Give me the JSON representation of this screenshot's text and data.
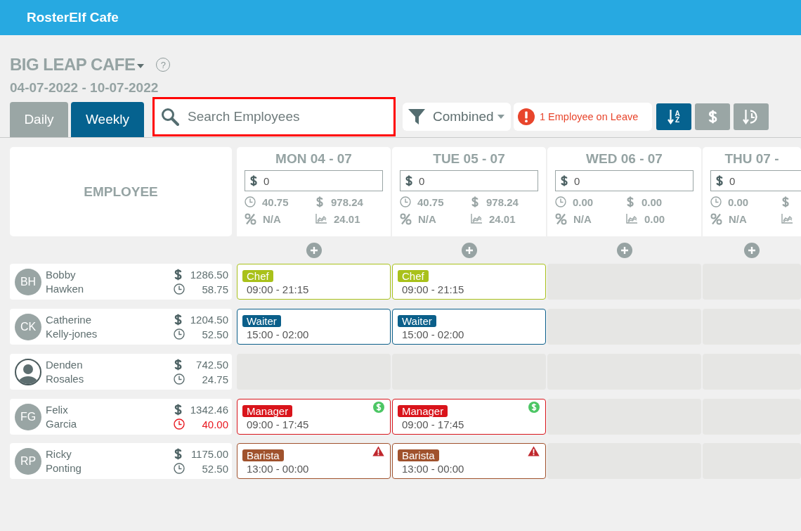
{
  "app": {
    "title": "RosterElf Cafe"
  },
  "location": {
    "name": "BIG LEAP CAFE",
    "help": "?"
  },
  "date_range": "04-07-2022 - 10-07-2022",
  "view_tabs": [
    {
      "label": "Daily",
      "selected": false
    },
    {
      "label": "Weekly",
      "selected": true
    }
  ],
  "search": {
    "placeholder": "Search Employees",
    "highlighted": true
  },
  "filter": {
    "value": "Combined"
  },
  "leave_notice": "1 Employee on Leave",
  "sort_buttons": [
    {
      "kind": "alpha",
      "letters": [
        "A",
        "Z"
      ],
      "selected": true
    },
    {
      "kind": "cost",
      "selected": false
    },
    {
      "kind": "hours",
      "selected": false
    }
  ],
  "employee_column": "EMPLOYEE",
  "days": [
    {
      "title": "MON 04 - 07",
      "budget": "0",
      "hours": "40.75",
      "cost": "978.24",
      "percent": "N/A",
      "ratio": "24.01"
    },
    {
      "title": "TUE 05 - 07",
      "budget": "0",
      "hours": "40.75",
      "cost": "978.24",
      "percent": "N/A",
      "ratio": "24.01"
    },
    {
      "title": "WED 06 - 07",
      "budget": "0",
      "hours": "0.00",
      "cost": "0.00",
      "percent": "N/A",
      "ratio": "0.00"
    },
    {
      "title": "THU 07 -",
      "budget": "0",
      "hours": "0.00",
      "percent": "N/A"
    }
  ],
  "employees": [
    {
      "first": "Bobby",
      "last": "Hawken",
      "initials": "BH",
      "cost": "1286.50",
      "hours": "58.75",
      "over_hours": false,
      "shifts": [
        {
          "kind": "shift",
          "role": "Chef",
          "time": "09:00 - 21:15",
          "color": "#a9c11a"
        },
        {
          "kind": "shift",
          "role": "Chef",
          "time": "09:00 - 21:15",
          "color": "#a9c11a"
        },
        {
          "kind": "empty"
        },
        {
          "kind": "empty"
        }
      ]
    },
    {
      "first": "Catherine",
      "last": "Kelly-jones",
      "initials": "CK",
      "cost": "1204.50",
      "hours": "52.50",
      "over_hours": false,
      "shifts": [
        {
          "kind": "shift",
          "role": "Waiter",
          "time": "15:00 - 02:00",
          "color": "#0b5f8a"
        },
        {
          "kind": "shift",
          "role": "Waiter",
          "time": "15:00 - 02:00",
          "color": "#0b5f8a"
        },
        {
          "kind": "empty"
        },
        {
          "kind": "empty"
        }
      ]
    },
    {
      "first": "Denden",
      "last": "Rosales",
      "cost": "742.50",
      "hours": "24.75",
      "over_hours": false,
      "shifts": [
        {
          "kind": "empty"
        },
        {
          "kind": "empty"
        },
        {
          "kind": "empty"
        },
        {
          "kind": "empty"
        }
      ]
    },
    {
      "first": "Felix",
      "last": "Garcia",
      "initials": "FG",
      "cost": "1342.46",
      "hours": "40.00",
      "over_hours": true,
      "shifts": [
        {
          "kind": "shift",
          "role": "Manager",
          "time": "09:00 - 17:45",
          "color": "#d9141b",
          "paid": true
        },
        {
          "kind": "shift",
          "role": "Manager",
          "time": "09:00 - 17:45",
          "color": "#d9141b",
          "paid": true
        },
        {
          "kind": "empty"
        },
        {
          "kind": "empty"
        }
      ]
    },
    {
      "first": "Ricky",
      "last": "Ponting",
      "initials": "RP",
      "cost": "1175.00",
      "hours": "52.50",
      "over_hours": false,
      "shifts": [
        {
          "kind": "shift",
          "role": "Barista",
          "time": "13:00 - 00:00",
          "color": "#a0522d",
          "warning": true
        },
        {
          "kind": "shift",
          "role": "Barista",
          "time": "13:00 - 00:00",
          "color": "#a0522d",
          "warning": true
        },
        {
          "kind": "empty"
        },
        {
          "kind": "empty"
        }
      ]
    }
  ]
}
